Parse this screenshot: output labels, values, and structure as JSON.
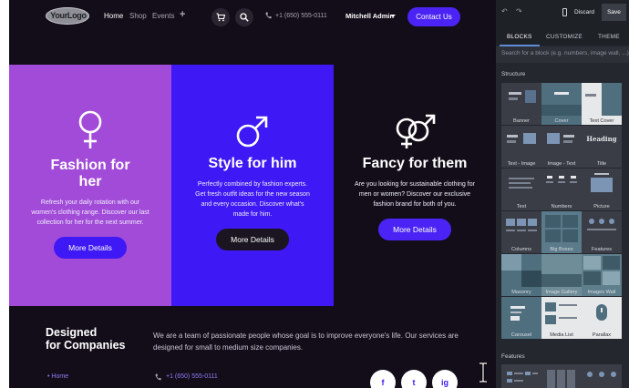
{
  "site": {
    "logo_text": "YourLogo",
    "nav": {
      "items": [
        "Home",
        "Shop",
        "Events"
      ],
      "add_icon": "plus-icon",
      "phone": "+1 (650) 555-0111",
      "user_name": "Mitchell Admin",
      "contact_label": "Contact Us"
    },
    "columns": [
      {
        "icon": "female-symbol-icon",
        "title_line1": "Fashion for",
        "title_line2": "her",
        "text": "Refresh your daily rotation with our women's clothing range. Discover our last collection for her for the next summer.",
        "button": "More Details"
      },
      {
        "icon": "male-symbol-icon",
        "title_line1": "Style for him",
        "title_line2": "",
        "text": "Perfectly combined by fashion experts. Get fresh outfit ideas for the new season and every occasion. Discover what's made for him.",
        "button": "More Details"
      },
      {
        "icon": "couple-symbol-icon",
        "title_line1": "Fancy for them",
        "title_line2": "",
        "text": "Are you looking for sustainable clothing for men or women? Discover our exclusive fashion brand for both of you.",
        "button": "More Details"
      }
    ],
    "footer": {
      "heading_line1": "Designed",
      "heading_line2": "for Companies",
      "about": "We are a team of passionate people whose goal is to improve everyone's life. Our services are designed for small to medium size companies.",
      "home_link": "• Home",
      "phone": "+1 (650) 555-0111",
      "social": [
        "f",
        "t",
        "ig"
      ]
    },
    "colors": {
      "background": "#130d19",
      "purple": "#a14bd8",
      "blue": "#3e18f5",
      "accent_button": "#4b24f5"
    }
  },
  "editor": {
    "undo_icon": "undo-icon",
    "redo_icon": "redo-icon",
    "mobile_icon": "mobile-preview-icon",
    "discard_label": "Discard",
    "save_label": "Save",
    "tabs": [
      "BLOCKS",
      "CUSTOMIZE",
      "THEME"
    ],
    "active_tab": "BLOCKS",
    "search_placeholder": "Search for a block (e.g. numbers, image wall, ...)",
    "structure_title": "Structure",
    "blocks": [
      "Banner",
      "Cover",
      "Text Cover",
      "Text - Image",
      "Image - Text",
      "Title",
      "Text",
      "Numbers",
      "Picture",
      "Columns",
      "Big Boxes",
      "Features",
      "Masonry",
      "Image Gallery",
      "Images Wall",
      "Carousel",
      "Media List",
      "Parallax"
    ],
    "title_block_preview": "Heading",
    "features_title": "Features"
  }
}
